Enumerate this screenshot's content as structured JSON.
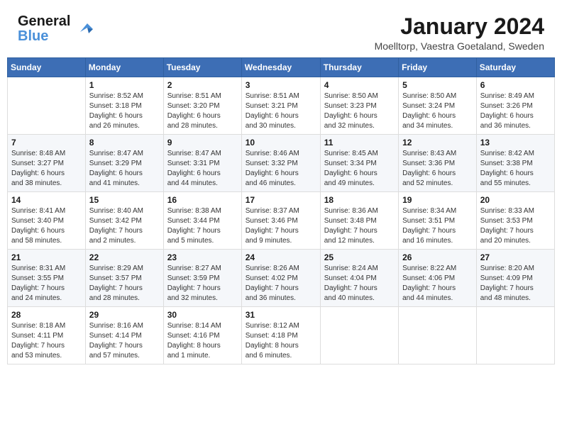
{
  "header": {
    "logo_line1": "General",
    "logo_line2": "Blue",
    "month_year": "January 2024",
    "location": "Moelltorp, Vaestra Goetaland, Sweden"
  },
  "days_of_week": [
    "Sunday",
    "Monday",
    "Tuesday",
    "Wednesday",
    "Thursday",
    "Friday",
    "Saturday"
  ],
  "weeks": [
    [
      {
        "day": "",
        "info": ""
      },
      {
        "day": "1",
        "info": "Sunrise: 8:52 AM\nSunset: 3:18 PM\nDaylight: 6 hours\nand 26 minutes."
      },
      {
        "day": "2",
        "info": "Sunrise: 8:51 AM\nSunset: 3:20 PM\nDaylight: 6 hours\nand 28 minutes."
      },
      {
        "day": "3",
        "info": "Sunrise: 8:51 AM\nSunset: 3:21 PM\nDaylight: 6 hours\nand 30 minutes."
      },
      {
        "day": "4",
        "info": "Sunrise: 8:50 AM\nSunset: 3:23 PM\nDaylight: 6 hours\nand 32 minutes."
      },
      {
        "day": "5",
        "info": "Sunrise: 8:50 AM\nSunset: 3:24 PM\nDaylight: 6 hours\nand 34 minutes."
      },
      {
        "day": "6",
        "info": "Sunrise: 8:49 AM\nSunset: 3:26 PM\nDaylight: 6 hours\nand 36 minutes."
      }
    ],
    [
      {
        "day": "7",
        "info": "Sunrise: 8:48 AM\nSunset: 3:27 PM\nDaylight: 6 hours\nand 38 minutes."
      },
      {
        "day": "8",
        "info": "Sunrise: 8:47 AM\nSunset: 3:29 PM\nDaylight: 6 hours\nand 41 minutes."
      },
      {
        "day": "9",
        "info": "Sunrise: 8:47 AM\nSunset: 3:31 PM\nDaylight: 6 hours\nand 44 minutes."
      },
      {
        "day": "10",
        "info": "Sunrise: 8:46 AM\nSunset: 3:32 PM\nDaylight: 6 hours\nand 46 minutes."
      },
      {
        "day": "11",
        "info": "Sunrise: 8:45 AM\nSunset: 3:34 PM\nDaylight: 6 hours\nand 49 minutes."
      },
      {
        "day": "12",
        "info": "Sunrise: 8:43 AM\nSunset: 3:36 PM\nDaylight: 6 hours\nand 52 minutes."
      },
      {
        "day": "13",
        "info": "Sunrise: 8:42 AM\nSunset: 3:38 PM\nDaylight: 6 hours\nand 55 minutes."
      }
    ],
    [
      {
        "day": "14",
        "info": "Sunrise: 8:41 AM\nSunset: 3:40 PM\nDaylight: 6 hours\nand 58 minutes."
      },
      {
        "day": "15",
        "info": "Sunrise: 8:40 AM\nSunset: 3:42 PM\nDaylight: 7 hours\nand 2 minutes."
      },
      {
        "day": "16",
        "info": "Sunrise: 8:38 AM\nSunset: 3:44 PM\nDaylight: 7 hours\nand 5 minutes."
      },
      {
        "day": "17",
        "info": "Sunrise: 8:37 AM\nSunset: 3:46 PM\nDaylight: 7 hours\nand 9 minutes."
      },
      {
        "day": "18",
        "info": "Sunrise: 8:36 AM\nSunset: 3:48 PM\nDaylight: 7 hours\nand 12 minutes."
      },
      {
        "day": "19",
        "info": "Sunrise: 8:34 AM\nSunset: 3:51 PM\nDaylight: 7 hours\nand 16 minutes."
      },
      {
        "day": "20",
        "info": "Sunrise: 8:33 AM\nSunset: 3:53 PM\nDaylight: 7 hours\nand 20 minutes."
      }
    ],
    [
      {
        "day": "21",
        "info": "Sunrise: 8:31 AM\nSunset: 3:55 PM\nDaylight: 7 hours\nand 24 minutes."
      },
      {
        "day": "22",
        "info": "Sunrise: 8:29 AM\nSunset: 3:57 PM\nDaylight: 7 hours\nand 28 minutes."
      },
      {
        "day": "23",
        "info": "Sunrise: 8:27 AM\nSunset: 3:59 PM\nDaylight: 7 hours\nand 32 minutes."
      },
      {
        "day": "24",
        "info": "Sunrise: 8:26 AM\nSunset: 4:02 PM\nDaylight: 7 hours\nand 36 minutes."
      },
      {
        "day": "25",
        "info": "Sunrise: 8:24 AM\nSunset: 4:04 PM\nDaylight: 7 hours\nand 40 minutes."
      },
      {
        "day": "26",
        "info": "Sunrise: 8:22 AM\nSunset: 4:06 PM\nDaylight: 7 hours\nand 44 minutes."
      },
      {
        "day": "27",
        "info": "Sunrise: 8:20 AM\nSunset: 4:09 PM\nDaylight: 7 hours\nand 48 minutes."
      }
    ],
    [
      {
        "day": "28",
        "info": "Sunrise: 8:18 AM\nSunset: 4:11 PM\nDaylight: 7 hours\nand 53 minutes."
      },
      {
        "day": "29",
        "info": "Sunrise: 8:16 AM\nSunset: 4:14 PM\nDaylight: 7 hours\nand 57 minutes."
      },
      {
        "day": "30",
        "info": "Sunrise: 8:14 AM\nSunset: 4:16 PM\nDaylight: 8 hours\nand 1 minute."
      },
      {
        "day": "31",
        "info": "Sunrise: 8:12 AM\nSunset: 4:18 PM\nDaylight: 8 hours\nand 6 minutes."
      },
      {
        "day": "",
        "info": ""
      },
      {
        "day": "",
        "info": ""
      },
      {
        "day": "",
        "info": ""
      }
    ]
  ]
}
